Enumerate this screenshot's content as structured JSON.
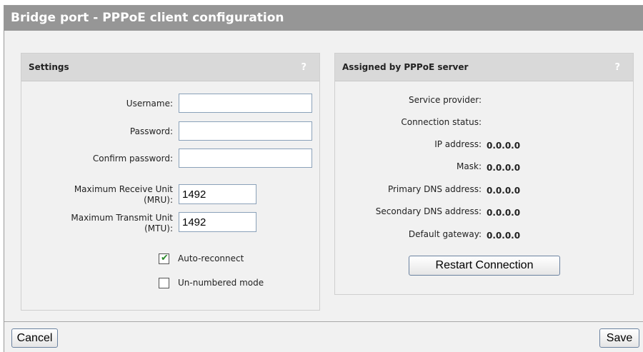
{
  "window": {
    "title": "Bridge port - PPPoE client configuration"
  },
  "settings": {
    "header": "Settings",
    "help": "?",
    "username_label": "Username:",
    "username_value": "",
    "password_label": "Password:",
    "password_value": "",
    "confirm_label": "Confirm password:",
    "confirm_value": "",
    "mru_label_line1": "Maximum Receive Unit",
    "mru_label_line2": "(MRU):",
    "mru_value": "1492",
    "mtu_label_line1": "Maximum Transmit Unit",
    "mtu_label_line2": "(MTU):",
    "mtu_value": "1492",
    "auto_reconnect_label": "Auto-reconnect",
    "auto_reconnect_checked": true,
    "unnumbered_label": "Un-numbered mode",
    "unnumbered_checked": false
  },
  "assigned": {
    "header": "Assigned by PPPoE server",
    "help": "?",
    "service_provider_label": "Service provider:",
    "service_provider_value": "",
    "connection_status_label": "Connection status:",
    "connection_status_value": "",
    "ip_label": "IP address:",
    "ip_value": "0.0.0.0",
    "mask_label": "Mask:",
    "mask_value": "0.0.0.0",
    "primary_dns_label": "Primary DNS address:",
    "primary_dns_value": "0.0.0.0",
    "secondary_dns_label": "Secondary DNS address:",
    "secondary_dns_value": "0.0.0.0",
    "gateway_label": "Default gateway:",
    "gateway_value": "0.0.0.0",
    "restart_button": "Restart Connection"
  },
  "footer": {
    "cancel_button": "Cancel",
    "save_button": "Save"
  }
}
